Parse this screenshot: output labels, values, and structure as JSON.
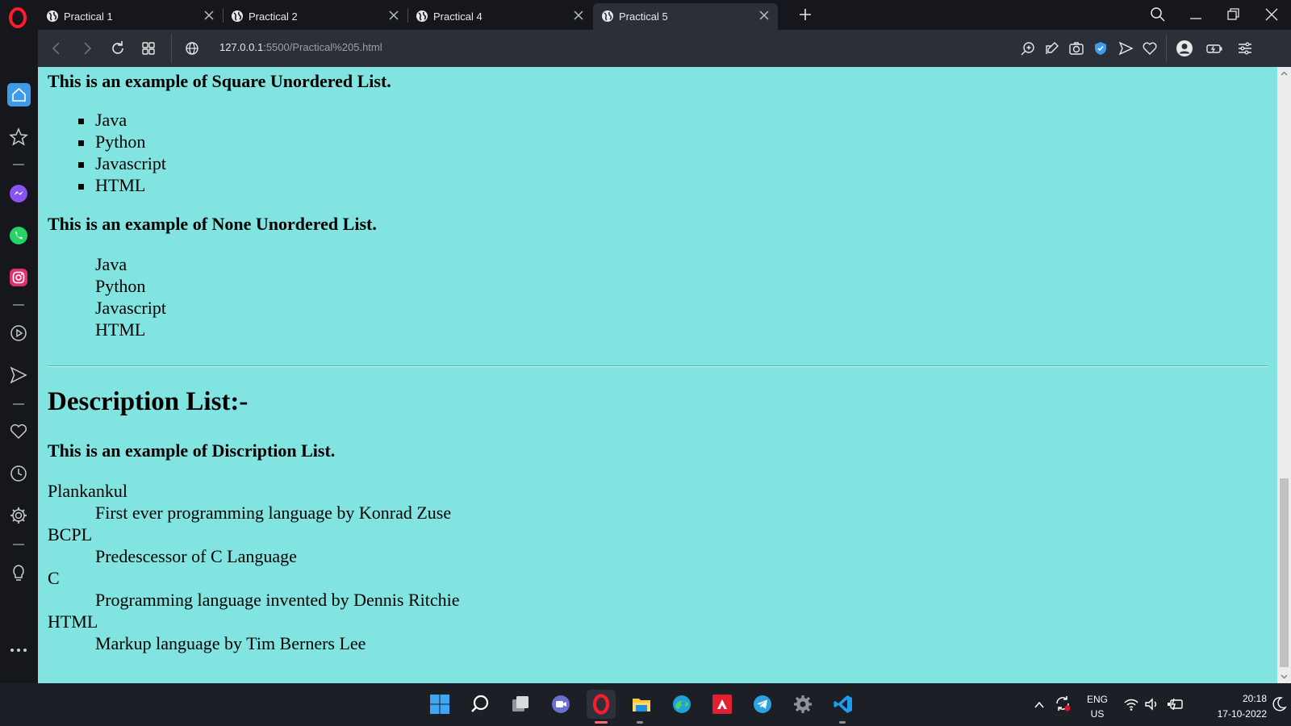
{
  "browser": {
    "tabs": [
      {
        "label": "Practical 1"
      },
      {
        "label": "Practical 2"
      },
      {
        "label": "Practical 4"
      },
      {
        "label": "Practical 5"
      }
    ],
    "active_tab": "Practical 5",
    "url_host": "127.0.0.1",
    "url_path": ":5500/Practical%205.html"
  },
  "page": {
    "square_heading": "This is an example of Square Unordered List.",
    "square_items": [
      "Java",
      "Python",
      "Javascript",
      "HTML"
    ],
    "none_heading": "This is an example of None Unordered List.",
    "none_items": [
      "Java",
      "Python",
      "Javascript",
      "HTML"
    ],
    "description_title": "Description List:-",
    "description_heading": "This is an example of Discription List.",
    "terms": [
      {
        "term": "Plankankul",
        "desc": "First ever programming language by Konrad Zuse"
      },
      {
        "term": "BCPL",
        "desc": "Predescessor of C Language"
      },
      {
        "term": "C",
        "desc": "Programming language invented by Dennis Ritchie"
      },
      {
        "term": "HTML",
        "desc": "Markup language by Tim Berners Lee"
      }
    ]
  },
  "taskbar": {
    "language": "ENG",
    "region": "US",
    "time": "20:18",
    "date": "17-10-2022"
  },
  "colors": {
    "page_background": "#81e4e0",
    "browser_chrome": "#2b2f38",
    "opera_red": "#ff1b2d",
    "sidebar_home": "#3d9be9"
  }
}
